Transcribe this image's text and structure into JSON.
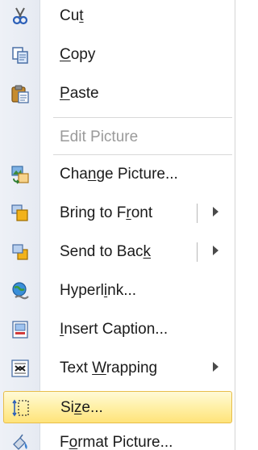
{
  "menu": {
    "items": [
      {
        "id": "cut",
        "pre": "Cu",
        "ul": "t",
        "post": "",
        "icon": "scissors-icon",
        "disabled": false,
        "submenu": false,
        "split": false
      },
      {
        "id": "copy",
        "pre": "",
        "ul": "C",
        "post": "opy",
        "icon": "copy-icon",
        "disabled": false,
        "submenu": false,
        "split": false
      },
      {
        "id": "paste",
        "pre": "",
        "ul": "P",
        "post": "aste",
        "icon": "paste-icon",
        "disabled": false,
        "submenu": false,
        "split": false
      },
      {
        "id": "edit-picture",
        "pre": "Edit Picture",
        "ul": "",
        "post": "",
        "icon": "",
        "disabled": true,
        "submenu": false,
        "split": false
      },
      {
        "id": "change-picture",
        "pre": "Cha",
        "ul": "n",
        "post": "ge Picture...",
        "icon": "change-picture-icon",
        "disabled": false,
        "submenu": false,
        "split": false
      },
      {
        "id": "bring-to-front",
        "pre": "Bring to F",
        "ul": "r",
        "post": "ont",
        "icon": "bring-to-front-icon",
        "disabled": false,
        "submenu": true,
        "split": true
      },
      {
        "id": "send-to-back",
        "pre": "Send to Bac",
        "ul": "k",
        "post": "",
        "icon": "send-to-back-icon",
        "disabled": false,
        "submenu": true,
        "split": true
      },
      {
        "id": "hyperlink",
        "pre": "Hyperl",
        "ul": "i",
        "post": "nk...",
        "icon": "hyperlink-icon",
        "disabled": false,
        "submenu": false,
        "split": false
      },
      {
        "id": "insert-caption",
        "pre": "",
        "ul": "I",
        "post": "nsert Caption...",
        "icon": "caption-icon",
        "disabled": false,
        "submenu": false,
        "split": false
      },
      {
        "id": "text-wrapping",
        "pre": "Text ",
        "ul": "W",
        "post": "rapping",
        "icon": "text-wrapping-icon",
        "disabled": false,
        "submenu": true,
        "split": false
      },
      {
        "id": "size",
        "pre": "Si",
        "ul": "z",
        "post": "e...",
        "icon": "size-icon",
        "disabled": false,
        "submenu": false,
        "split": false,
        "highlighted": true
      },
      {
        "id": "format-picture",
        "pre": "F",
        "ul": "o",
        "post": "rmat Picture...",
        "icon": "format-picture-icon",
        "disabled": false,
        "submenu": false,
        "split": false
      }
    ]
  }
}
